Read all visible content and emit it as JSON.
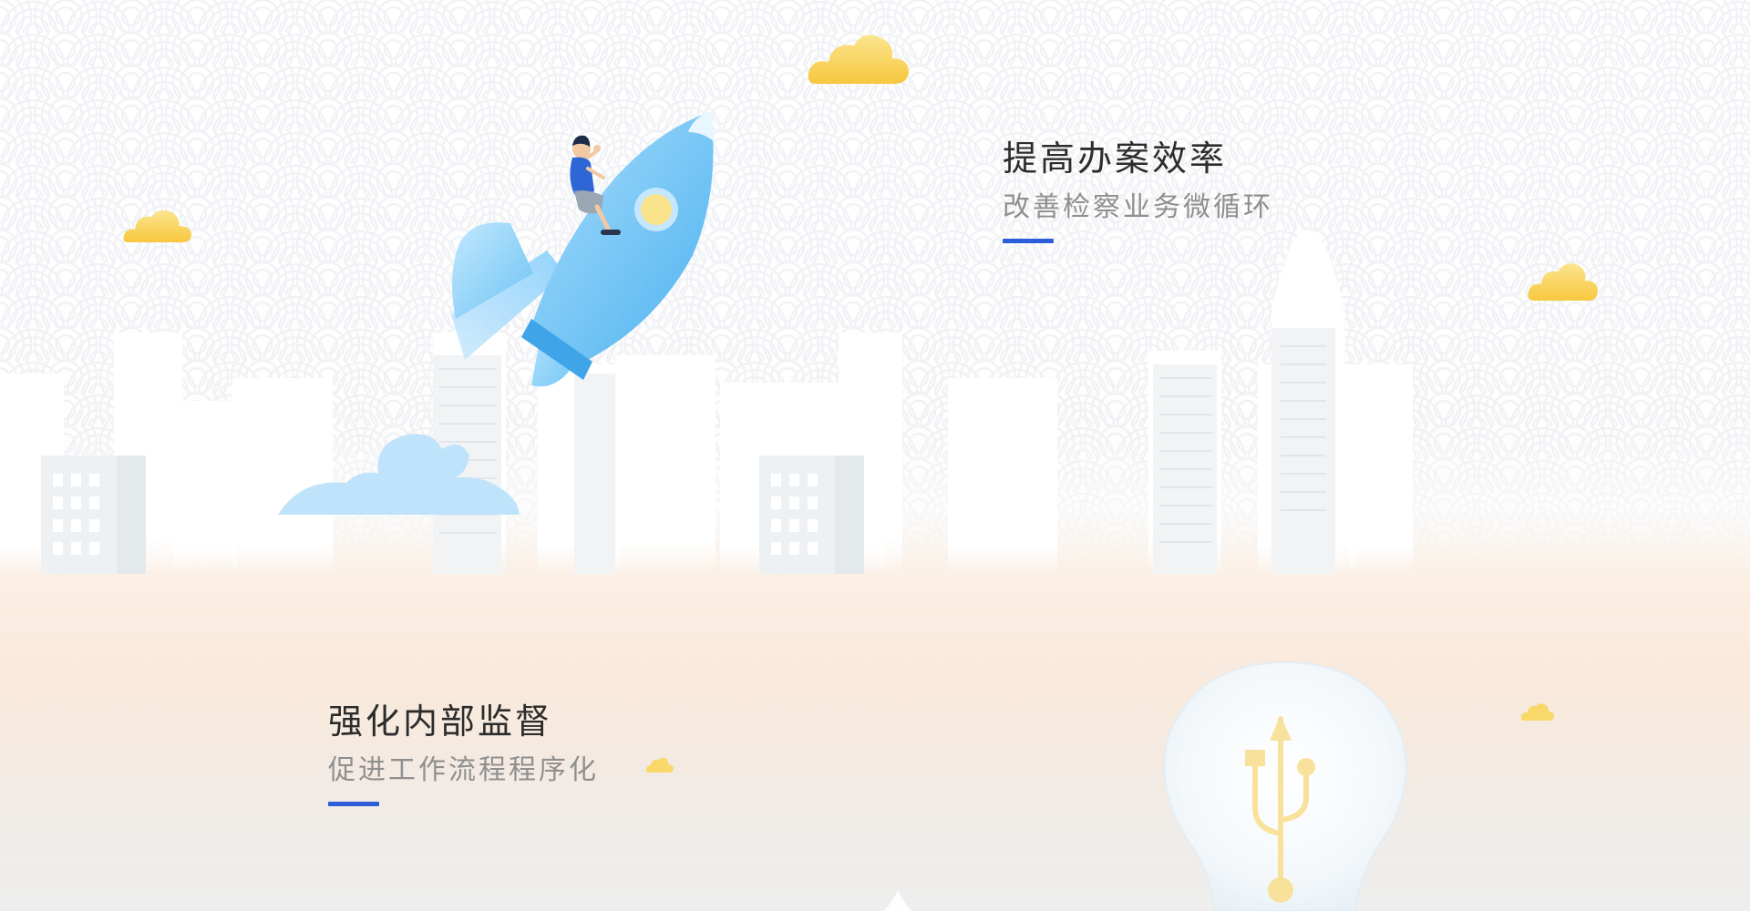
{
  "features": [
    {
      "title": "提高办案效率",
      "subtitle": "改善检察业务微循环"
    },
    {
      "title": "强化内部监督",
      "subtitle": "促进工作流程程序化"
    }
  ],
  "colors": {
    "accent_underline": "#2d5dd8",
    "title_text": "#2c2c2c",
    "subtitle_text": "#8f8f8f",
    "rocket_blue": "#6cc3f5",
    "cloud_yellow": "#f9d25a",
    "exhaust_blue": "#bfe3fa",
    "bulb_glass": "#eef5f9",
    "usb_symbol_yellow": "#f8e29b"
  },
  "icons": {
    "rocket": "rocket-with-person-icon",
    "bulb": "lightbulb-usb-icon",
    "cloud": "cloud-icon"
  }
}
